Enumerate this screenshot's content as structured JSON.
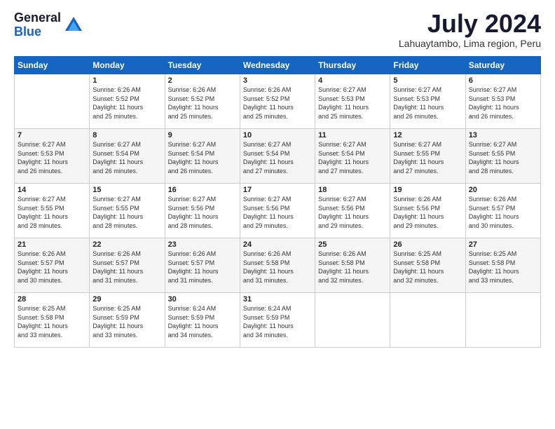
{
  "logo": {
    "general": "General",
    "blue": "Blue"
  },
  "header": {
    "month_year": "July 2024",
    "location": "Lahuaytambo, Lima region, Peru"
  },
  "days_of_week": [
    "Sunday",
    "Monday",
    "Tuesday",
    "Wednesday",
    "Thursday",
    "Friday",
    "Saturday"
  ],
  "weeks": [
    [
      {
        "day": "",
        "info": ""
      },
      {
        "day": "1",
        "info": "Sunrise: 6:26 AM\nSunset: 5:52 PM\nDaylight: 11 hours\nand 25 minutes."
      },
      {
        "day": "2",
        "info": "Sunrise: 6:26 AM\nSunset: 5:52 PM\nDaylight: 11 hours\nand 25 minutes."
      },
      {
        "day": "3",
        "info": "Sunrise: 6:26 AM\nSunset: 5:52 PM\nDaylight: 11 hours\nand 25 minutes."
      },
      {
        "day": "4",
        "info": "Sunrise: 6:27 AM\nSunset: 5:53 PM\nDaylight: 11 hours\nand 25 minutes."
      },
      {
        "day": "5",
        "info": "Sunrise: 6:27 AM\nSunset: 5:53 PM\nDaylight: 11 hours\nand 26 minutes."
      },
      {
        "day": "6",
        "info": "Sunrise: 6:27 AM\nSunset: 5:53 PM\nDaylight: 11 hours\nand 26 minutes."
      }
    ],
    [
      {
        "day": "7",
        "info": "Sunrise: 6:27 AM\nSunset: 5:53 PM\nDaylight: 11 hours\nand 26 minutes."
      },
      {
        "day": "8",
        "info": "Sunrise: 6:27 AM\nSunset: 5:54 PM\nDaylight: 11 hours\nand 26 minutes."
      },
      {
        "day": "9",
        "info": "Sunrise: 6:27 AM\nSunset: 5:54 PM\nDaylight: 11 hours\nand 26 minutes."
      },
      {
        "day": "10",
        "info": "Sunrise: 6:27 AM\nSunset: 5:54 PM\nDaylight: 11 hours\nand 27 minutes."
      },
      {
        "day": "11",
        "info": "Sunrise: 6:27 AM\nSunset: 5:54 PM\nDaylight: 11 hours\nand 27 minutes."
      },
      {
        "day": "12",
        "info": "Sunrise: 6:27 AM\nSunset: 5:55 PM\nDaylight: 11 hours\nand 27 minutes."
      },
      {
        "day": "13",
        "info": "Sunrise: 6:27 AM\nSunset: 5:55 PM\nDaylight: 11 hours\nand 28 minutes."
      }
    ],
    [
      {
        "day": "14",
        "info": "Sunrise: 6:27 AM\nSunset: 5:55 PM\nDaylight: 11 hours\nand 28 minutes."
      },
      {
        "day": "15",
        "info": "Sunrise: 6:27 AM\nSunset: 5:55 PM\nDaylight: 11 hours\nand 28 minutes."
      },
      {
        "day": "16",
        "info": "Sunrise: 6:27 AM\nSunset: 5:56 PM\nDaylight: 11 hours\nand 28 minutes."
      },
      {
        "day": "17",
        "info": "Sunrise: 6:27 AM\nSunset: 5:56 PM\nDaylight: 11 hours\nand 29 minutes."
      },
      {
        "day": "18",
        "info": "Sunrise: 6:27 AM\nSunset: 5:56 PM\nDaylight: 11 hours\nand 29 minutes."
      },
      {
        "day": "19",
        "info": "Sunrise: 6:26 AM\nSunset: 5:56 PM\nDaylight: 11 hours\nand 29 minutes."
      },
      {
        "day": "20",
        "info": "Sunrise: 6:26 AM\nSunset: 5:57 PM\nDaylight: 11 hours\nand 30 minutes."
      }
    ],
    [
      {
        "day": "21",
        "info": "Sunrise: 6:26 AM\nSunset: 5:57 PM\nDaylight: 11 hours\nand 30 minutes."
      },
      {
        "day": "22",
        "info": "Sunrise: 6:26 AM\nSunset: 5:57 PM\nDaylight: 11 hours\nand 31 minutes."
      },
      {
        "day": "23",
        "info": "Sunrise: 6:26 AM\nSunset: 5:57 PM\nDaylight: 11 hours\nand 31 minutes."
      },
      {
        "day": "24",
        "info": "Sunrise: 6:26 AM\nSunset: 5:58 PM\nDaylight: 11 hours\nand 31 minutes."
      },
      {
        "day": "25",
        "info": "Sunrise: 6:26 AM\nSunset: 5:58 PM\nDaylight: 11 hours\nand 32 minutes."
      },
      {
        "day": "26",
        "info": "Sunrise: 6:25 AM\nSunset: 5:58 PM\nDaylight: 11 hours\nand 32 minutes."
      },
      {
        "day": "27",
        "info": "Sunrise: 6:25 AM\nSunset: 5:58 PM\nDaylight: 11 hours\nand 33 minutes."
      }
    ],
    [
      {
        "day": "28",
        "info": "Sunrise: 6:25 AM\nSunset: 5:58 PM\nDaylight: 11 hours\nand 33 minutes."
      },
      {
        "day": "29",
        "info": "Sunrise: 6:25 AM\nSunset: 5:59 PM\nDaylight: 11 hours\nand 33 minutes."
      },
      {
        "day": "30",
        "info": "Sunrise: 6:24 AM\nSunset: 5:59 PM\nDaylight: 11 hours\nand 34 minutes."
      },
      {
        "day": "31",
        "info": "Sunrise: 6:24 AM\nSunset: 5:59 PM\nDaylight: 11 hours\nand 34 minutes."
      },
      {
        "day": "",
        "info": ""
      },
      {
        "day": "",
        "info": ""
      },
      {
        "day": "",
        "info": ""
      }
    ]
  ]
}
